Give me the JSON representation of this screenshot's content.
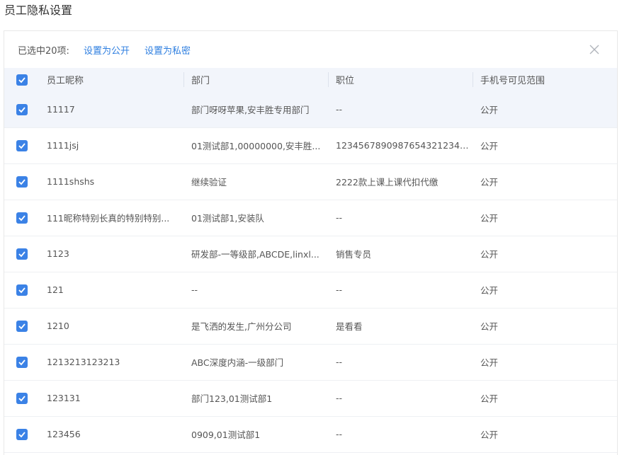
{
  "title": "员工隐私设置",
  "toolbar": {
    "selected_text": "已选中20项:",
    "set_public": "设置为公开",
    "set_private": "设置为私密"
  },
  "colors": {
    "accent": "#3b82e6",
    "link": "#2f7fe0",
    "header_bg": "#f2f5fb"
  },
  "table": {
    "columns": [
      "员工昵称",
      "部门",
      "职位",
      "手机号可见范围"
    ],
    "rows": [
      {
        "name": "11117",
        "dept": "部门呀呀苹果,安丰胜专用部门",
        "position": "--",
        "scope": "公开",
        "checked": true
      },
      {
        "name": "1111jsj",
        "dept": "01测试部1,00000000,安丰胜...",
        "position": "12345678909876543212345 6...",
        "scope": "公开",
        "checked": true
      },
      {
        "name": "1111shshs",
        "dept": "继续验证",
        "position": "2222款上课上课代扣代缴",
        "scope": "公开",
        "checked": true
      },
      {
        "name": "111昵称特别长真的特别特别...",
        "dept": "01测试部1,安装队",
        "position": "--",
        "scope": "公开",
        "checked": true
      },
      {
        "name": "1123",
        "dept": "研发部-一等级部,ABCDE,linxl...",
        "position": "销售专员",
        "scope": "公开",
        "checked": true
      },
      {
        "name": "121",
        "dept": "--",
        "position": "--",
        "scope": "公开",
        "checked": true
      },
      {
        "name": "1210",
        "dept": "是飞洒的发生,广州分公司",
        "position": "是看看",
        "scope": "公开",
        "checked": true
      },
      {
        "name": "1213213123213",
        "dept": "ABC深度内涵-一级部门",
        "position": "--",
        "scope": "公开",
        "checked": true
      },
      {
        "name": "123131",
        "dept": "部门123,01测试部1",
        "position": "--",
        "scope": "公开",
        "checked": true
      },
      {
        "name": "123456",
        "dept": "0909,01测试部1",
        "position": "--",
        "scope": "公开",
        "checked": true
      }
    ]
  }
}
